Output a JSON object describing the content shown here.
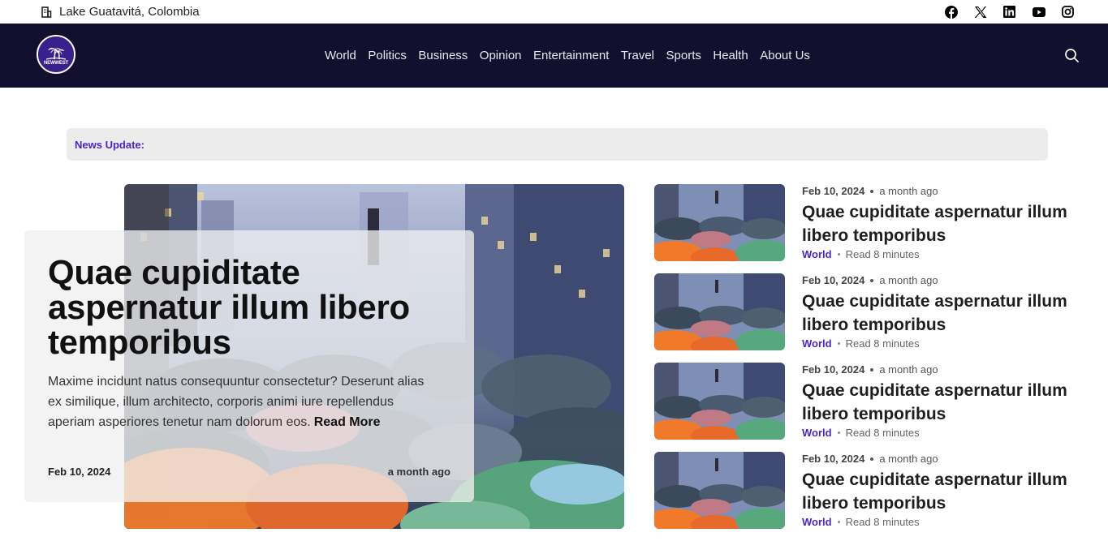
{
  "topbar": {
    "location": "Lake Guatavitá, Colombia",
    "location_icon": "building-icon",
    "socials": [
      "facebook-icon",
      "x-icon",
      "linkedin-icon",
      "youtube-icon",
      "instagram-icon"
    ]
  },
  "nav": {
    "logo_text": "NEWWEST",
    "links": [
      "World",
      "Politics",
      "Business",
      "Opinion",
      "Entertainment",
      "Travel",
      "Sports",
      "Health",
      "About Us"
    ],
    "search_icon": "search-icon"
  },
  "ticker": {
    "label": "News Update:"
  },
  "hero": {
    "title": "Quae cupiditate aspernatur illum libero temporibus",
    "excerpt": "Maxime incidunt natus consequuntur consectetur? Deserunt alias ex similique, illum architecto, corporis animi iure repellendus aperiam asperiores tenetur nam dolorum eos.",
    "read_more": "Read More",
    "date": "Feb 10, 2024",
    "ago": "a month ago"
  },
  "side_articles": [
    {
      "date": "Feb 10, 2024",
      "ago": "a month ago",
      "title": "Quae cupiditate aspernatur illum libero temporibus",
      "category": "World",
      "read": "Read 8 minutes"
    },
    {
      "date": "Feb 10, 2024",
      "ago": "a month ago",
      "title": "Quae cupiditate aspernatur illum libero temporibus",
      "category": "World",
      "read": "Read 8 minutes"
    },
    {
      "date": "Feb 10, 2024",
      "ago": "a month ago",
      "title": "Quae cupiditate aspernatur illum libero temporibus",
      "category": "World",
      "read": "Read 8 minutes"
    },
    {
      "date": "Feb 10, 2024",
      "ago": "a month ago",
      "title": "Quae cupiditate aspernatur illum libero temporibus",
      "category": "World",
      "read": "Read 8 minutes"
    }
  ],
  "colors": {
    "nav_bg": "#130f2f",
    "accent": "#4a25c9",
    "ticker_bg": "#ececec"
  }
}
